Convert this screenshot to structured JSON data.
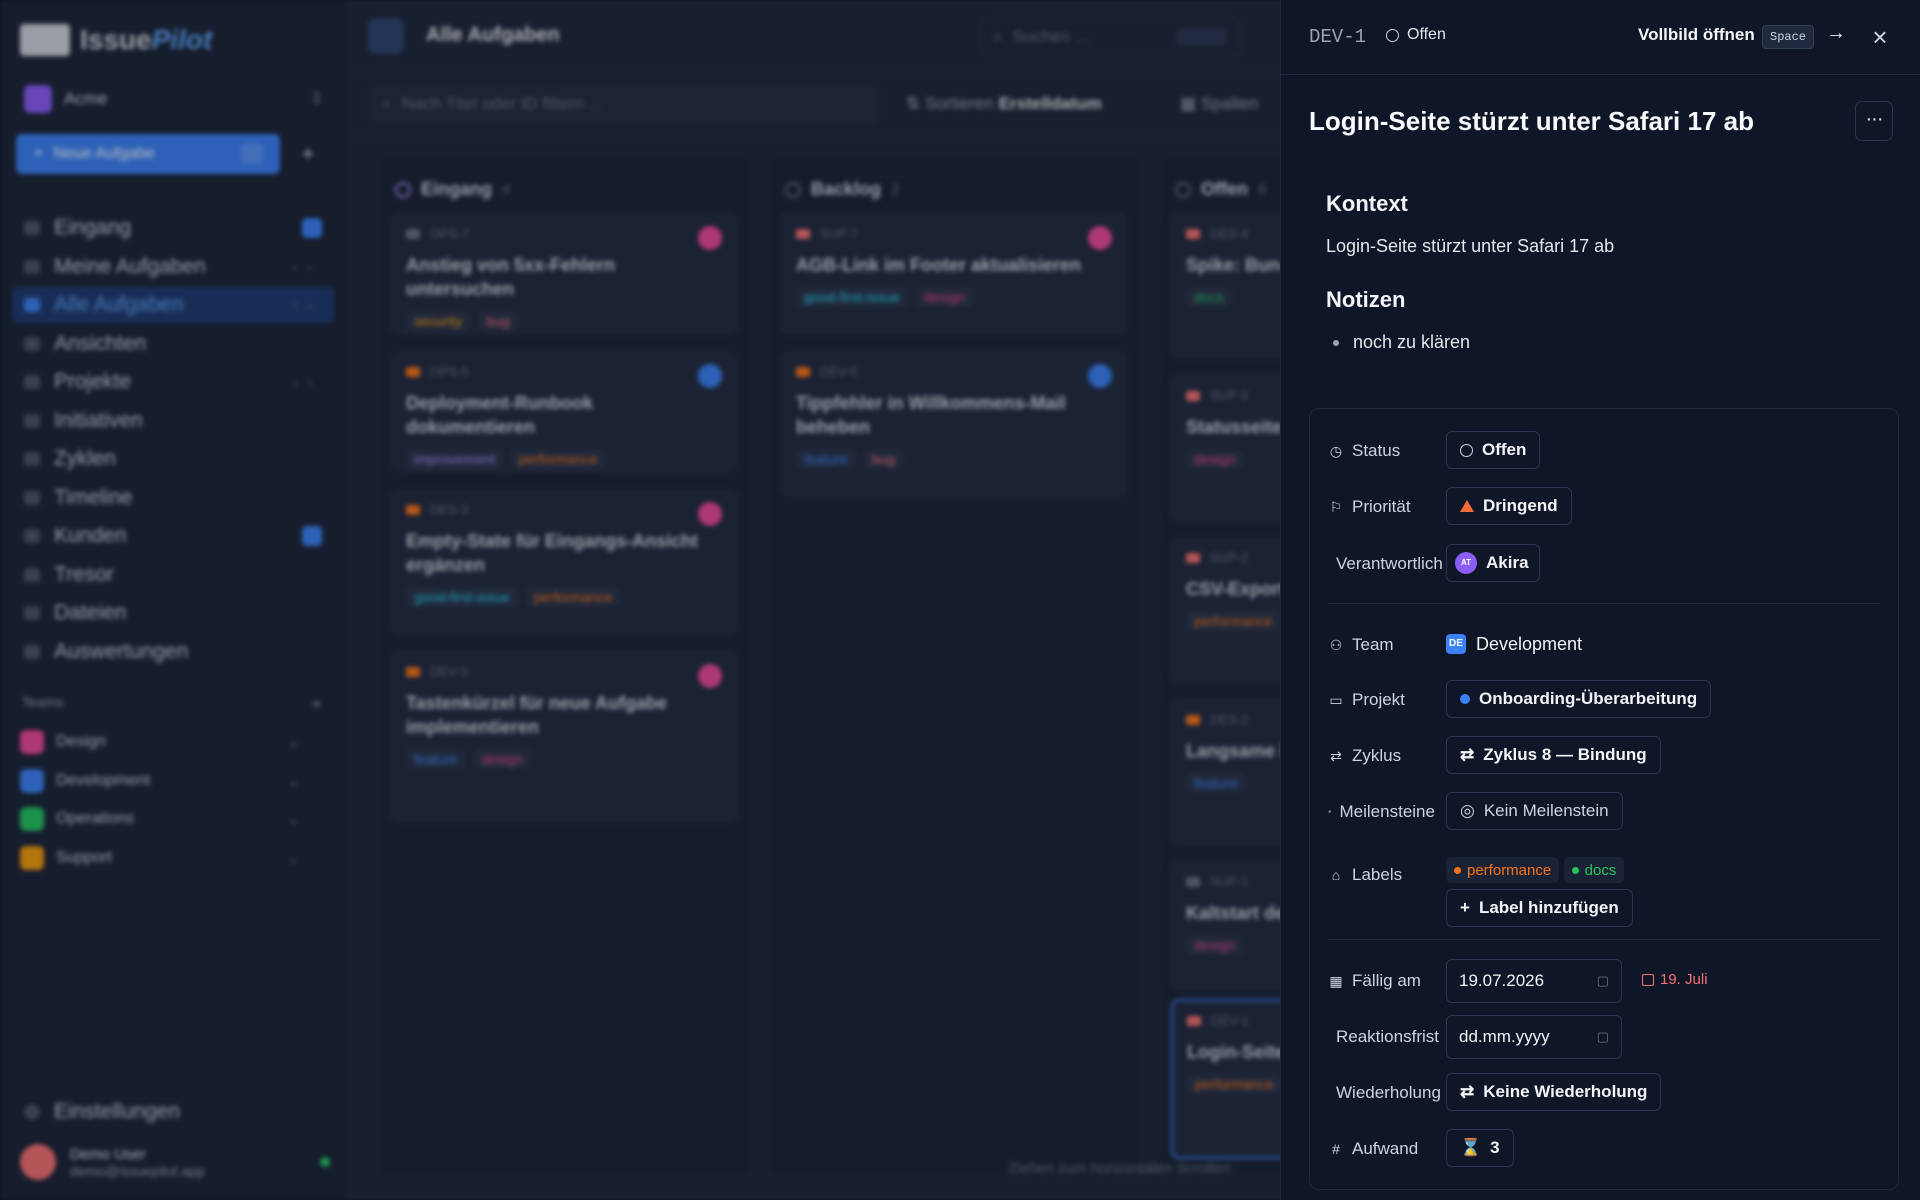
{
  "app": {
    "logo_issue": "Issue",
    "logo_pilot": "Pilot",
    "workspace": "Acme",
    "new_task_label": "Neue Aufgabe",
    "nav": [
      {
        "label": "Eingang"
      },
      {
        "label": "Meine Aufgaben"
      },
      {
        "label": "Alle Aufgaben"
      },
      {
        "label": "Ansichten"
      },
      {
        "label": "Projekte"
      },
      {
        "label": "Initiativen"
      },
      {
        "label": "Zyklen"
      },
      {
        "label": "Timeline"
      },
      {
        "label": "Kunden"
      },
      {
        "label": "Tresor"
      },
      {
        "label": "Dateien"
      },
      {
        "label": "Auswertungen"
      }
    ],
    "teams_heading": "Teams",
    "teams": [
      {
        "label": "Design",
        "color": "#ec4899"
      },
      {
        "label": "Development",
        "color": "#3b82f6"
      },
      {
        "label": "Operations",
        "color": "#22c55e"
      },
      {
        "label": "Support",
        "color": "#f59e0b"
      }
    ],
    "settings_label": "Einstellungen",
    "user": {
      "name": "Demo User",
      "email": "demo@issuepilot.app"
    },
    "page_title": "Alle Aufgaben",
    "search_placeholder": "Suchen ...",
    "filter_placeholder": "Nach Titel oder ID filtern ...",
    "sort_label": "Sortieren",
    "sort_value": "Erstelldatum",
    "columns_label": "Spalten",
    "scroll_hint": "Ziehen zum horizontalen Scrollen",
    "columns": [
      {
        "name": "Eingang",
        "count": "4",
        "cards": [
          {
            "id": "OPS-7",
            "title": "Anstieg von 5xx-Fehlern untersuchen",
            "tags": [
              "security",
              "bug"
            ]
          },
          {
            "id": "OPS-5",
            "title": "Deployment-Runbook dokumentieren",
            "tags": [
              "improvement",
              "performance"
            ]
          },
          {
            "id": "DES-3",
            "title": "Empty-State für Eingangs-Ansicht ergänzen",
            "tags": [
              "good-first-issue",
              "performance"
            ]
          },
          {
            "id": "DEV-3",
            "title": "Tastenkürzel für neue Aufgabe implementieren",
            "tags": [
              "feature",
              "design"
            ]
          }
        ]
      },
      {
        "name": "Backlog",
        "count": "2",
        "cards": [
          {
            "id": "SUP-7",
            "title": "AGB-Link im Footer aktualisieren",
            "tags": [
              "good-first-issue",
              "design"
            ]
          },
          {
            "id": "DEV-6",
            "title": "Tippfehler in Willkommens-Mail beheben",
            "tags": [
              "feature",
              "bug"
            ]
          }
        ]
      },
      {
        "name": "Offen",
        "count": "6",
        "cards": [
          {
            "id": "DES-4",
            "title": "Spike: Bun-Runtime evaluieren",
            "tags": [
              "docs"
            ]
          },
          {
            "id": "SUP-3",
            "title": "Statusseite defekt",
            "tags": [
              "design"
            ]
          },
          {
            "id": "SUP-2",
            "title": "CSV-Export hinzufügen",
            "tags": [
              "performance"
            ]
          },
          {
            "id": "DES-2",
            "title": "Langsame Filter",
            "tags": [
              "feature"
            ]
          },
          {
            "id": "SUP-1",
            "title": "Kaltstart der",
            "tags": [
              "design"
            ]
          },
          {
            "id": "DEV-1",
            "title": "Login-Seite",
            "tags": [
              "performance"
            ]
          }
        ]
      }
    ]
  },
  "panel": {
    "issue_id": "DEV-1",
    "status": "Offen",
    "open_fullscreen": "Vollbild öffnen",
    "shortcut": "Space",
    "title": "Login-Seite stürzt unter Safari 17 ab",
    "context_heading": "Kontext",
    "context_text": "Login-Seite stürzt unter Safari 17 ab",
    "notes_heading": "Notizen",
    "notes": [
      "noch zu klären"
    ],
    "props": {
      "status_label": "Status",
      "status_value": "Offen",
      "priority_label": "Priorität",
      "priority_value": "Dringend",
      "assignee_label": "Verantwortlich",
      "assignee_initials": "AT",
      "assignee_value": "Akira",
      "team_label": "Team",
      "team_badge": "DE",
      "team_value": "Development",
      "project_label": "Projekt",
      "project_value": "Onboarding-Überarbeitung",
      "cycle_label": "Zyklus",
      "cycle_value": "Zyklus 8 — Bindung",
      "milestones_label": "Meilensteine",
      "milestones_value": "Kein Meilenstein",
      "labels_label": "Labels",
      "labels": [
        {
          "name": "performance",
          "color": "#f97316"
        },
        {
          "name": "docs",
          "color": "#22c55e"
        }
      ],
      "add_label": "Label hinzufügen",
      "due_label": "Fällig am",
      "due_value": "19.07.2026",
      "due_hint": "19. Juli",
      "response_label": "Reaktionsfrist",
      "response_placeholder": "dd.mm.yyyy",
      "recurrence_label": "Wiederholung",
      "recurrence_value": "Keine Wiederholung",
      "effort_label": "Aufwand",
      "effort_value": "3"
    }
  }
}
